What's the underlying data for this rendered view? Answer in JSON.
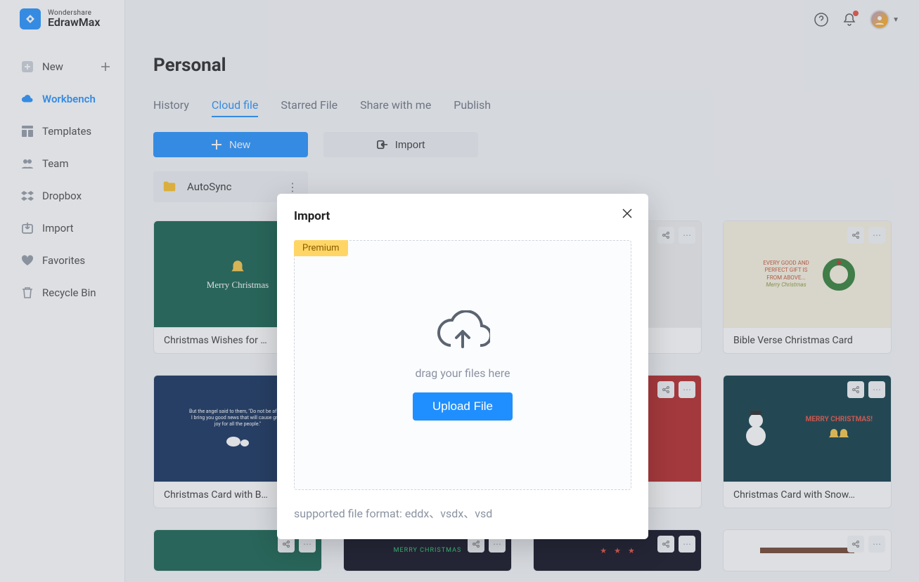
{
  "brand": {
    "company": "Wondershare",
    "product": "EdrawMax"
  },
  "sidebar": {
    "items": [
      {
        "label": "New"
      },
      {
        "label": "Workbench"
      },
      {
        "label": "Templates"
      },
      {
        "label": "Team"
      },
      {
        "label": "Dropbox"
      },
      {
        "label": "Import"
      },
      {
        "label": "Favorites"
      },
      {
        "label": "Recycle Bin"
      }
    ]
  },
  "page": {
    "title": "Personal",
    "tabs": [
      "History",
      "Cloud file",
      "Starred File",
      "Share with me",
      "Publish"
    ],
    "active_tab_index": 1,
    "actions": {
      "new": "New",
      "import": "Import"
    },
    "folder": "AutoSync"
  },
  "cards": [
    {
      "title": "Christmas Wishes for …",
      "thumb_text": "Merry Christmas"
    },
    {
      "title": "",
      "thumb_text": ""
    },
    {
      "title": "…",
      "thumb_text": ""
    },
    {
      "title": "Bible Verse Christmas Card",
      "thumb_text": "Merry Christmas"
    },
    {
      "title": "Christmas Card with B…",
      "thumb_text": ""
    },
    {
      "title": "",
      "thumb_text": ""
    },
    {
      "title": "…",
      "thumb_text": ""
    },
    {
      "title": "Christmas Card with Snow…",
      "thumb_text": "MERRY CHRISTMAS!"
    },
    {
      "title": "",
      "thumb_text": ""
    },
    {
      "title": "",
      "thumb_text": "MERRY CHRISTMAS"
    },
    {
      "title": "",
      "thumb_text": ""
    },
    {
      "title": "",
      "thumb_text": ""
    }
  ],
  "modal": {
    "title": "Import",
    "badge": "Premium",
    "drag_text": "drag your files here",
    "upload_label": "Upload File",
    "formats": "supported file format: eddx、vsdx、vsd"
  },
  "colors": {
    "accent": "#1f8fff",
    "badge": "#ffd666"
  }
}
